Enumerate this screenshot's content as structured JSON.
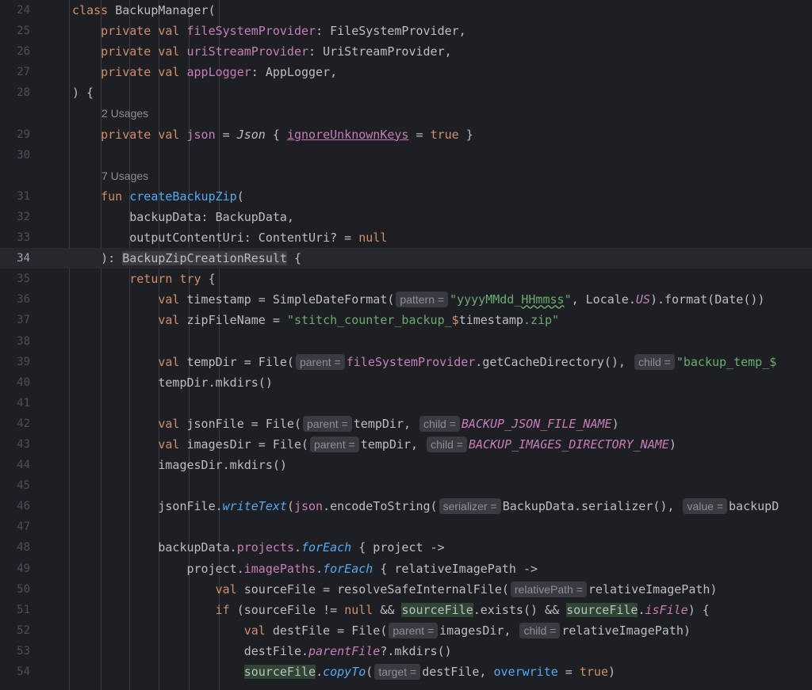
{
  "lines": [
    {
      "num": "24",
      "usage": "",
      "tokens": [
        [
          "kw",
          "class "
        ],
        [
          "",
          "BackupManager("
        ]
      ]
    },
    {
      "num": "25",
      "tokens": [
        [
          "",
          "    "
        ],
        [
          "kw",
          "private val "
        ],
        [
          "pr",
          "fileSystemProvider"
        ],
        [
          "",
          ": FileSystemProvider,"
        ]
      ]
    },
    {
      "num": "26",
      "tokens": [
        [
          "",
          "    "
        ],
        [
          "kw",
          "private val "
        ],
        [
          "pr",
          "uriStreamProvider"
        ],
        [
          "",
          ": UriStreamProvider,"
        ]
      ]
    },
    {
      "num": "27",
      "tokens": [
        [
          "",
          "    "
        ],
        [
          "kw",
          "private val "
        ],
        [
          "pr",
          "appLogger"
        ],
        [
          "",
          ": AppLogger,"
        ]
      ]
    },
    {
      "num": "28",
      "tokens": [
        [
          "",
          ") {"
        ]
      ]
    },
    {
      "usage": "2 Usages",
      "indent": 1
    },
    {
      "num": "29",
      "tokens": [
        [
          "",
          "    "
        ],
        [
          "kw",
          "private val "
        ],
        [
          "pr",
          "json"
        ],
        [
          "",
          " = "
        ],
        [
          "it",
          "Json"
        ],
        [
          "",
          " { "
        ],
        [
          "pr ul",
          "ignoreUnknownKeys"
        ],
        [
          "",
          " = "
        ],
        [
          "kw",
          "true"
        ],
        [
          "",
          " }"
        ]
      ]
    },
    {
      "num": "30",
      "tokens": []
    },
    {
      "usage": "7 Usages",
      "indent": 1
    },
    {
      "num": "31",
      "tokens": [
        [
          "",
          "    "
        ],
        [
          "kw",
          "fun "
        ],
        [
          "fn",
          "createBackupZip"
        ],
        [
          "",
          "("
        ]
      ]
    },
    {
      "num": "32",
      "tokens": [
        [
          "",
          "        backupData: BackupData,"
        ]
      ]
    },
    {
      "num": "33",
      "tokens": [
        [
          "",
          "        outputContentUri: ContentUri? = "
        ],
        [
          "kw",
          "null"
        ]
      ]
    },
    {
      "num": "34",
      "current": true,
      "tokens": [
        [
          "",
          "    ): "
        ],
        [
          "hl2",
          "BackupZipCreationResult"
        ],
        [
          "",
          " {"
        ]
      ]
    },
    {
      "num": "35",
      "tokens": [
        [
          "",
          "        "
        ],
        [
          "kw",
          "return try"
        ],
        [
          "",
          " {"
        ]
      ]
    },
    {
      "num": "36",
      "tokens": [
        [
          "",
          "            "
        ],
        [
          "kw",
          "val "
        ],
        [
          "",
          "timestamp = SimpleDateFormat("
        ],
        [
          "hint",
          "pattern ="
        ],
        [
          "st",
          "\"yyyyMMdd_"
        ],
        [
          "st wavy",
          "HHmmss"
        ],
        [
          "st",
          "\""
        ],
        [
          "",
          ", Locale."
        ],
        [
          "con",
          "US"
        ],
        [
          "",
          ").format(Date())"
        ]
      ]
    },
    {
      "num": "37",
      "tokens": [
        [
          "",
          "            "
        ],
        [
          "kw",
          "val "
        ],
        [
          "",
          "zipFileName = "
        ],
        [
          "st",
          "\"stitch_counter_backup_"
        ],
        [
          "kw",
          "$"
        ],
        [
          "",
          "timestamp"
        ],
        [
          "st",
          ".zip\""
        ]
      ]
    },
    {
      "num": "38",
      "tokens": []
    },
    {
      "num": "39",
      "tokens": [
        [
          "",
          "            "
        ],
        [
          "kw",
          "val "
        ],
        [
          "",
          "tempDir = File("
        ],
        [
          "hint",
          "parent ="
        ],
        [
          "pr",
          "fileSystemProvider"
        ],
        [
          "",
          ".getCacheDirectory(), "
        ],
        [
          "hint",
          "child ="
        ],
        [
          "st",
          "\"backup_temp_$"
        ]
      ]
    },
    {
      "num": "40",
      "tokens": [
        [
          "",
          "            tempDir.mkdirs()"
        ]
      ]
    },
    {
      "num": "41",
      "tokens": []
    },
    {
      "num": "42",
      "tokens": [
        [
          "",
          "            "
        ],
        [
          "kw",
          "val "
        ],
        [
          "",
          "jsonFile = File("
        ],
        [
          "hint",
          "parent ="
        ],
        [
          "",
          "tempDir, "
        ],
        [
          "hint",
          "child ="
        ],
        [
          "con",
          "BACKUP_JSON_FILE_NAME"
        ],
        [
          "",
          ")"
        ]
      ]
    },
    {
      "num": "43",
      "tokens": [
        [
          "",
          "            "
        ],
        [
          "kw",
          "val "
        ],
        [
          "",
          "imagesDir = File("
        ],
        [
          "hint",
          "parent ="
        ],
        [
          "",
          "tempDir, "
        ],
        [
          "hint",
          "child ="
        ],
        [
          "con",
          "BACKUP_IMAGES_DIRECTORY_NAME"
        ],
        [
          "",
          ")"
        ]
      ]
    },
    {
      "num": "44",
      "tokens": [
        [
          "",
          "            imagesDir.mkdirs()"
        ]
      ]
    },
    {
      "num": "45",
      "tokens": []
    },
    {
      "num": "46",
      "tokens": [
        [
          "",
          "            jsonFile."
        ],
        [
          "fn it",
          "writeText"
        ],
        [
          "",
          "("
        ],
        [
          "pr",
          "json"
        ],
        [
          "",
          ".encodeToString("
        ],
        [
          "hint",
          "serializer ="
        ],
        [
          "",
          "BackupData.serializer(), "
        ],
        [
          "hint",
          "value ="
        ],
        [
          "",
          "backupD"
        ]
      ]
    },
    {
      "num": "47",
      "tokens": []
    },
    {
      "num": "48",
      "tokens": [
        [
          "",
          "            backupData."
        ],
        [
          "pr",
          "projects"
        ],
        [
          "",
          "."
        ],
        [
          "fn it",
          "forEach"
        ],
        [
          "",
          " { project ->"
        ]
      ]
    },
    {
      "num": "49",
      "tokens": [
        [
          "",
          "                project."
        ],
        [
          "pr",
          "imagePaths"
        ],
        [
          "",
          "."
        ],
        [
          "fn it",
          "forEach"
        ],
        [
          "",
          " { relativeImagePath ->"
        ]
      ]
    },
    {
      "num": "50",
      "tokens": [
        [
          "",
          "                    "
        ],
        [
          "kw",
          "val "
        ],
        [
          "",
          "sourceFile = resolveSafeInternalFile("
        ],
        [
          "hint",
          "relativePath ="
        ],
        [
          "",
          "relativeImagePath)"
        ]
      ]
    },
    {
      "num": "51",
      "tokens": [
        [
          "",
          "                    "
        ],
        [
          "kw",
          "if "
        ],
        [
          "",
          "(sourceFile != "
        ],
        [
          "kw",
          "null"
        ],
        [
          "",
          " && "
        ],
        [
          "hl",
          "sourceFile"
        ],
        [
          "",
          ".exists() && "
        ],
        [
          "hl",
          "sourceFile"
        ],
        [
          "",
          "."
        ],
        [
          "pr it",
          "isFile"
        ],
        [
          "",
          ") {"
        ]
      ]
    },
    {
      "num": "52",
      "tokens": [
        [
          "",
          "                        "
        ],
        [
          "kw",
          "val "
        ],
        [
          "",
          "destFile = File("
        ],
        [
          "hint",
          "parent ="
        ],
        [
          "",
          "imagesDir, "
        ],
        [
          "hint",
          "child ="
        ],
        [
          "",
          "relativeImagePath)"
        ]
      ]
    },
    {
      "num": "53",
      "tokens": [
        [
          "",
          "                        destFile."
        ],
        [
          "pr it",
          "parentFile"
        ],
        [
          "",
          "?.mkdirs()"
        ]
      ]
    },
    {
      "num": "54",
      "tokens": [
        [
          "",
          "                        "
        ],
        [
          "hl",
          "sourceFile"
        ],
        [
          "",
          "."
        ],
        [
          "fn it",
          "copyTo"
        ],
        [
          "",
          "("
        ],
        [
          "hint",
          "target ="
        ],
        [
          "",
          "destFile, "
        ],
        [
          "fn",
          "overwrite"
        ],
        [
          "",
          " = "
        ],
        [
          "kw",
          "true"
        ],
        [
          "",
          ")"
        ]
      ]
    }
  ]
}
